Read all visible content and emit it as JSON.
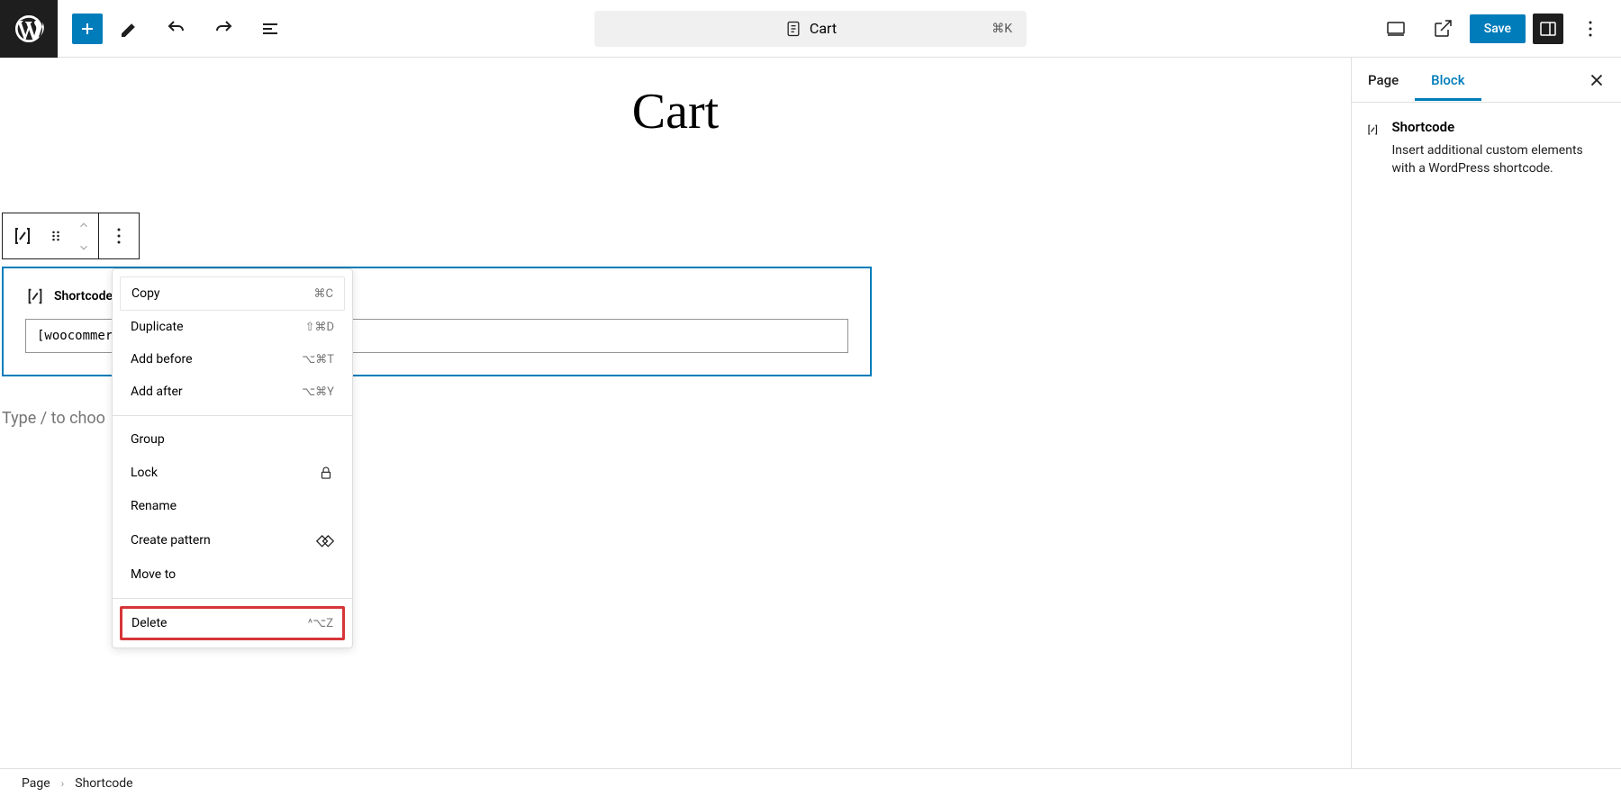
{
  "topbar": {
    "document_title": "Cart",
    "command_shortcut": "⌘K",
    "save_label": "Save"
  },
  "editor": {
    "page_title": "Cart",
    "shortcode": {
      "label": "Shortcode",
      "value": "[woocommer"
    },
    "paragraph_placeholder": "Type / to choo"
  },
  "context_menu": {
    "items": [
      {
        "label": "Copy",
        "shortcut": "⌘C",
        "first": true
      },
      {
        "label": "Duplicate",
        "shortcut": "⇧⌘D"
      },
      {
        "label": "Add before",
        "shortcut": "⌥⌘T"
      },
      {
        "label": "Add after",
        "shortcut": "⌥⌘Y"
      },
      {
        "sep": true
      },
      {
        "label": "Group"
      },
      {
        "label": "Lock",
        "icon": "lock"
      },
      {
        "label": "Rename"
      },
      {
        "label": "Create pattern",
        "icon": "pattern"
      },
      {
        "label": "Move to"
      },
      {
        "sep": true
      },
      {
        "label": "Delete",
        "shortcut": "^⌥Z",
        "highlighted": true
      }
    ]
  },
  "sidebar": {
    "tabs": [
      {
        "label": "Page",
        "active": false
      },
      {
        "label": "Block",
        "active": true
      }
    ],
    "block": {
      "title": "Shortcode",
      "description": "Insert additional custom elements with a WordPress shortcode."
    }
  },
  "breadcrumb": {
    "items": [
      "Page",
      "Shortcode"
    ]
  }
}
